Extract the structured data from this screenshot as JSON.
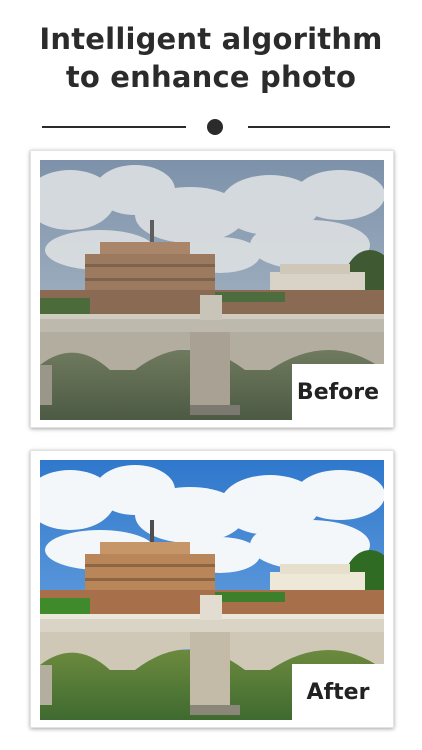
{
  "headline": {
    "line1": "Intelligent algorithm",
    "line2": "to enhance photo"
  },
  "before_card": {
    "label": "Before",
    "image": "photo-castel-sant-angelo-bridge"
  },
  "after_card": {
    "label": "After",
    "image": "photo-castel-sant-angelo-bridge-enhanced"
  },
  "colors": {
    "text": "#2b2b2b",
    "before_sky": "#8fa3b8",
    "after_sky": "#3f86d6"
  }
}
